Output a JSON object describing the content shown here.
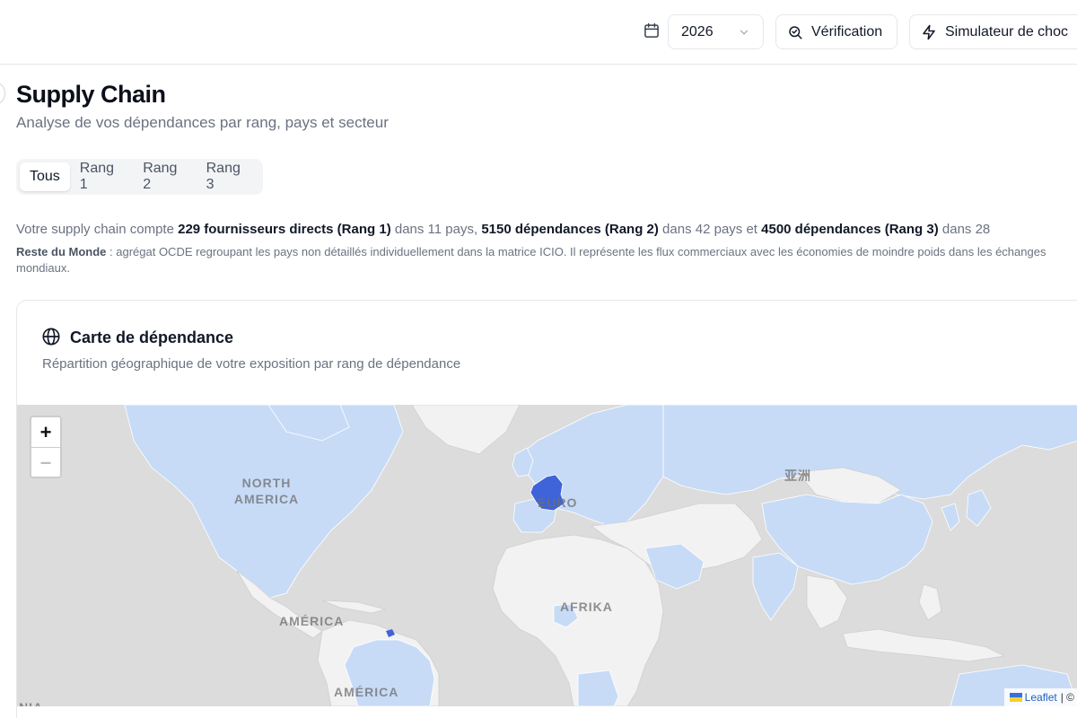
{
  "header": {
    "year": "2026",
    "verification_label": "Vérification",
    "simulator_label": "Simulateur de choc"
  },
  "page": {
    "title": "Supply Chain",
    "subtitle": "Analyse de vos dépendances par rang, pays et secteur"
  },
  "tabs": [
    {
      "label": "Tous",
      "active": true
    },
    {
      "label": "Rang 1",
      "active": false
    },
    {
      "label": "Rang 2",
      "active": false
    },
    {
      "label": "Rang 3",
      "active": false
    }
  ],
  "summary": {
    "prefix": "Votre supply chain compte ",
    "rank1": "229 fournisseurs directs (Rang 1)",
    "rank1_suffix": " dans 11 pays, ",
    "rank2": "5150 dépendances (Rang 2)",
    "rank2_suffix": " dans 42 pays et ",
    "rank3": "4500 dépendances (Rang 3)",
    "rank3_suffix": " dans 28"
  },
  "note": {
    "term": "Reste du Monde",
    "text": " : agrégat OCDE regroupant les pays non détaillés individuellement dans la matrice ICIO. Il représente les flux commerciaux avec les économies de moindre poids dans les échanges mondiaux."
  },
  "map_card": {
    "title": "Carte de dépendance",
    "subtitle": "Répartition géographique de votre exposition par rang de dépendance",
    "zoom_in": "+",
    "zoom_out": "–",
    "labels": {
      "north_america": "NORTH\nAMERICA",
      "europe": "EURO",
      "asia": "亚洲",
      "africa": "AFRIKA",
      "america": "AMÉRICA",
      "south_america": "AMÉRICA",
      "na_partial": "NIA"
    },
    "attribution": {
      "leaflet": "Leaflet",
      "separator": "| ©"
    },
    "colors": {
      "ocean": "#dcdcdc",
      "land": "#f2f2f2",
      "exposed": "#c7dbf7",
      "highlight": "#3f63d9"
    }
  }
}
